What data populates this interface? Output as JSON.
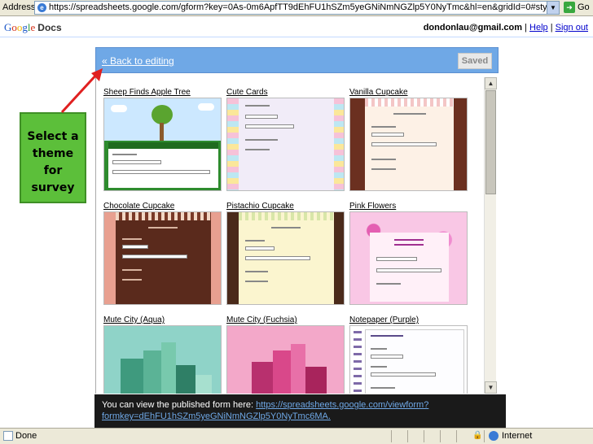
{
  "browser": {
    "address_label": "Address",
    "url": "https://spreadsheets.google.com/gform?key=0As-0m6ApfTT9dEhFU1hSZm5yeGNiNmNGZlp5Y0NyTmc&hl=en&gridId=0#style",
    "go_label": "Go",
    "status_text": "Done",
    "zone_text": "Internet"
  },
  "header": {
    "logo_parts": [
      "G",
      "o",
      "o",
      "g",
      "l",
      "e"
    ],
    "product": "Docs",
    "email": "dondonlau@gmail.com",
    "separator": " | ",
    "help_link": "Help",
    "signout_link": "Sign out"
  },
  "editor": {
    "back_link": "« Back to editing",
    "saved_label": "Saved"
  },
  "themes": [
    {
      "name": "Sheep Finds Apple Tree"
    },
    {
      "name": "Cute Cards"
    },
    {
      "name": "Vanilla Cupcake"
    },
    {
      "name": "Chocolate Cupcake"
    },
    {
      "name": "Pistachio Cupcake"
    },
    {
      "name": "Pink Flowers"
    },
    {
      "name": "Mute City (Aqua)"
    },
    {
      "name": "Mute City (Fuchsia)"
    },
    {
      "name": "Notepaper (Purple)"
    }
  ],
  "callout": {
    "text": "Select a\ntheme\nfor\nsurvey"
  },
  "notice": {
    "text": "You can view the published form here: ",
    "link": "https://spreadsheets.google.com/viewform?formkey=dEhFU1hSZm5yeGNiNmNGZlp5Y0NyTmc6MA",
    "link_line1": "https://spreadsheets.google.com/viewform?",
    "link_line2": "formkey=dEhFU1hSZm5yeGNiNmNGZlp5Y0NyTmc6MA."
  },
  "icons": {
    "dropdown": "chevron-down-icon",
    "go": "go-arrow-icon",
    "done": "page-icon",
    "lock": "lock-icon",
    "zone": "globe-icon"
  },
  "colors": {
    "panel_bar": "#6fa8e6",
    "callout": "#5cbf3a",
    "arrow": "#e02020",
    "notice_bg": "#1a1a1a"
  }
}
